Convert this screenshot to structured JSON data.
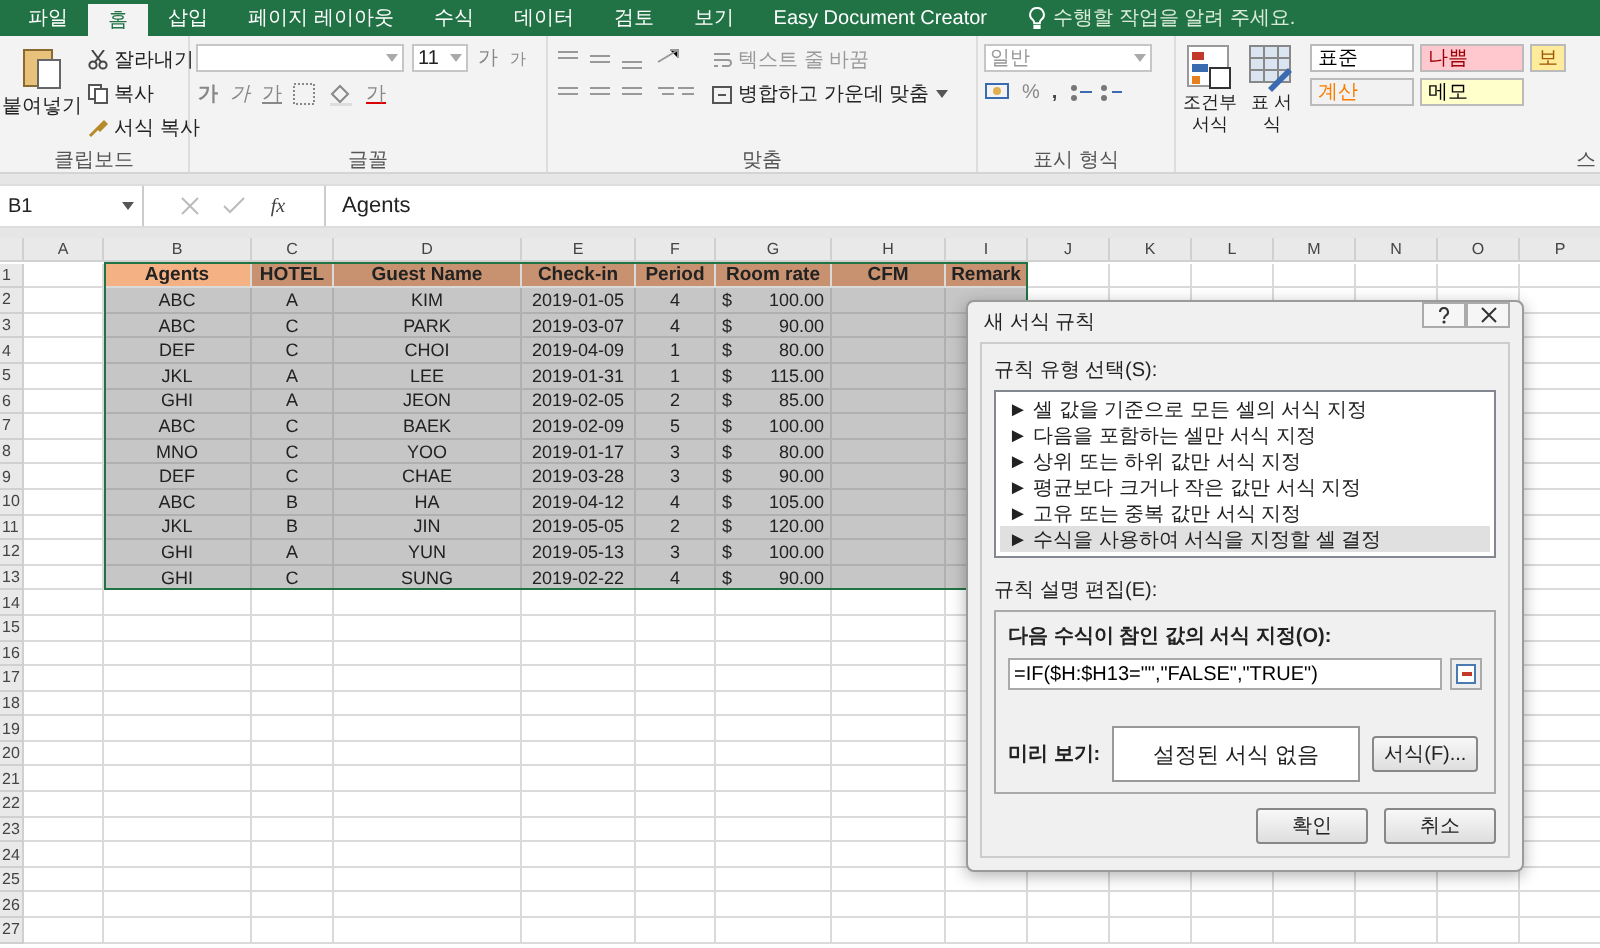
{
  "tabs": [
    {
      "label": "파일",
      "selected": false
    },
    {
      "label": "홈",
      "selected": true
    },
    {
      "label": "삽입",
      "selected": false
    },
    {
      "label": "페이지 레이아웃",
      "selected": false
    },
    {
      "label": "수식",
      "selected": false
    },
    {
      "label": "데이터",
      "selected": false
    },
    {
      "label": "검토",
      "selected": false
    },
    {
      "label": "보기",
      "selected": false
    },
    {
      "label": "Easy Document Creator",
      "selected": false
    }
  ],
  "tell_me": {
    "placeholder": "수행할 작업을 알려 주세요."
  },
  "ribbon": {
    "clipboard": {
      "paste": "붙여넣기",
      "cut": "잘라내기",
      "copy": "복사",
      "format_painter": "서식 복사",
      "label": "클립보드"
    },
    "font": {
      "size": "11",
      "grow": "가",
      "shrink": "가",
      "bold": "가",
      "italic": "가",
      "underline": "가",
      "font_color": "가",
      "label": "글꼴"
    },
    "alignment": {
      "wrap": "텍스트 줄 바꿈",
      "merge": "병합하고 가운데 맞춤",
      "label": "맞춤"
    },
    "number": {
      "format": "일반",
      "percent": "%",
      "comma": ",",
      "label": "표시 형식"
    },
    "styles": {
      "conditional": "조건부 서식",
      "table": "표 서식",
      "label": "스",
      "cells": [
        {
          "label": "표준",
          "color": "#ffffff",
          "kind": "normal"
        },
        {
          "label": "나쁨",
          "color": "#ffc7ce",
          "kind": "bad"
        },
        {
          "label": "보",
          "color": "#ffeb9c",
          "kind": "neutral"
        },
        {
          "label": "계산",
          "color": "#f2f2f2",
          "kind": "calculation"
        },
        {
          "label": "메모",
          "color": "#ffffcc",
          "kind": "note"
        }
      ]
    }
  },
  "formula_bar": {
    "name_box": "B1",
    "function_button": "fx",
    "value": "Agents"
  },
  "sheet_frame": {
    "column_headers": [
      "A",
      "B",
      "C",
      "D",
      "E",
      "F",
      "G",
      "H",
      "I",
      "J",
      "K",
      "L",
      "M",
      "N",
      "O",
      "P"
    ],
    "row_headers": [
      "1",
      "2",
      "3",
      "4",
      "5",
      "6",
      "7",
      "8",
      "9",
      "10",
      "11",
      "12",
      "13",
      "14",
      "15",
      "16",
      "17",
      "18",
      "19",
      "20",
      "21",
      "22",
      "23",
      "24",
      "25",
      "26",
      "27"
    ]
  },
  "table": {
    "header": [
      {
        "text": "Agents",
        "active": true
      },
      {
        "text": "HOTEL",
        "active": false
      },
      {
        "text": "Guest Name",
        "active": false
      },
      {
        "text": "Check-in",
        "active": false
      },
      {
        "text": "Period",
        "active": false
      },
      {
        "text": "Room rate",
        "active": false
      },
      {
        "text": "CFM",
        "active": false
      },
      {
        "text": "Remark",
        "active": false
      }
    ],
    "rows": [
      {
        "cells": [
          "ABC",
          "A",
          "KIM",
          "2019-01-05",
          "4"
        ],
        "currency": "$",
        "rate": "100.00"
      },
      {
        "cells": [
          "ABC",
          "C",
          "PARK",
          "2019-03-07",
          "4"
        ],
        "currency": "$",
        "rate": "90.00"
      },
      {
        "cells": [
          "DEF",
          "C",
          "CHOI",
          "2019-04-09",
          "1"
        ],
        "currency": "$",
        "rate": "80.00"
      },
      {
        "cells": [
          "JKL",
          "A",
          "LEE",
          "2019-01-31",
          "1"
        ],
        "currency": "$",
        "rate": "115.00"
      },
      {
        "cells": [
          "GHI",
          "A",
          "JEON",
          "2019-02-05",
          "2"
        ],
        "currency": "$",
        "rate": "85.00"
      },
      {
        "cells": [
          "ABC",
          "C",
          "BAEK",
          "2019-02-09",
          "5"
        ],
        "currency": "$",
        "rate": "100.00"
      },
      {
        "cells": [
          "MNO",
          "C",
          "YOO",
          "2019-01-17",
          "3"
        ],
        "currency": "$",
        "rate": "80.00"
      },
      {
        "cells": [
          "DEF",
          "C",
          "CHAE",
          "2019-03-28",
          "3"
        ],
        "currency": "$",
        "rate": "90.00"
      },
      {
        "cells": [
          "ABC",
          "B",
          "HA",
          "2019-04-12",
          "4"
        ],
        "currency": "$",
        "rate": "105.00"
      },
      {
        "cells": [
          "JKL",
          "B",
          "JIN",
          "2019-05-05",
          "2"
        ],
        "currency": "$",
        "rate": "120.00"
      },
      {
        "cells": [
          "GHI",
          "A",
          "YUN",
          "2019-05-13",
          "3"
        ],
        "currency": "$",
        "rate": "100.00"
      },
      {
        "cells": [
          "GHI",
          "C",
          "SUNG",
          "2019-02-22",
          "4"
        ],
        "currency": "$",
        "rate": "90.00"
      }
    ]
  },
  "dialog": {
    "title": "새 서식 규칙",
    "type_label": "규칙 유형 선택(S):",
    "rule_types": [
      {
        "label": "► 셀 값을 기준으로 모든 셀의 서식 지정",
        "selected": false
      },
      {
        "label": "► 다음을 포함하는 셀만 서식 지정",
        "selected": false
      },
      {
        "label": "► 상위 또는 하위 값만 서식 지정",
        "selected": false
      },
      {
        "label": "► 평균보다 크거나 작은 값만 서식 지정",
        "selected": false
      },
      {
        "label": "► 고유 또는 중복 값만 서식 지정",
        "selected": false
      },
      {
        "label": "► 수식을 사용하여 서식을 지정할 셀 결정",
        "selected": true
      }
    ],
    "edit_label": "규칙 설명 편집(E):",
    "formula_label": "다음 수식이 참인 값의 서식 지정(O):",
    "formula": "=IF($H:$H13=\"\",\"FALSE\",\"TRUE\")",
    "preview_label": "미리 보기:",
    "preview_text": "설정된 서식 없음",
    "format_button": "서식(F)...",
    "ok": "확인",
    "cancel": "취소"
  }
}
